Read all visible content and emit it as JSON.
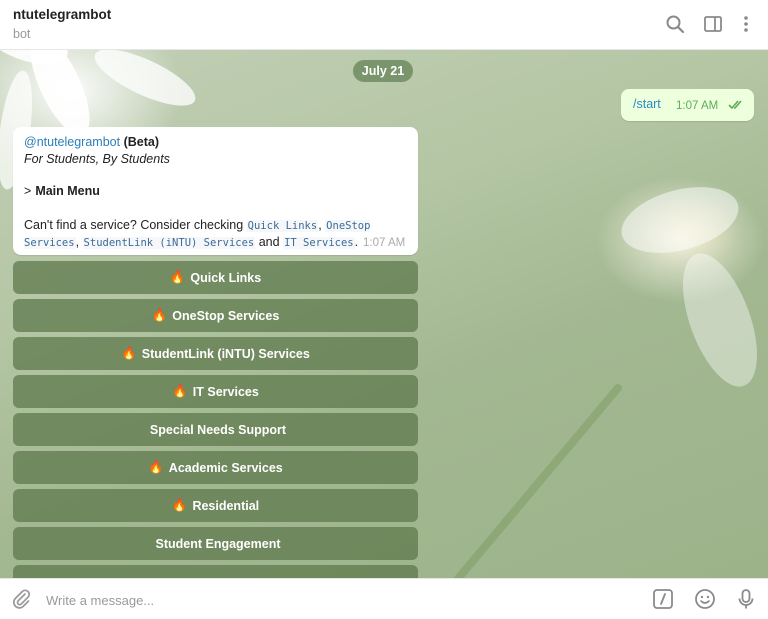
{
  "header": {
    "title": "ntutelegrambot",
    "subtitle": "bot"
  },
  "chat": {
    "date_label": "July 21",
    "outgoing": {
      "text": "/start",
      "time": "1:07 AM"
    },
    "incoming": {
      "mention": "@ntutelegrambot",
      "beta": "(Beta)",
      "tagline": "For Students, By Students",
      "arrow": ">",
      "menu_label": "Main Menu",
      "help_prefix": "Can't find a service? Consider checking",
      "link_quick": "Quick Links",
      "sep1": ",",
      "link_onestop": "OneStop Services",
      "sep2": ",",
      "link_studentlink": "StudentLink (iNTU) Services",
      "and_word": "and",
      "link_it": "IT Services",
      "period": ".",
      "time": "1:07 AM"
    },
    "keyboard": [
      {
        "fire": "🔥",
        "label": "Quick Links"
      },
      {
        "fire": "🔥",
        "label": "OneStop Services"
      },
      {
        "fire": "🔥",
        "label": "StudentLink (iNTU) Services"
      },
      {
        "fire": "🔥",
        "label": "IT Services"
      },
      {
        "fire": "",
        "label": "Special Needs Support"
      },
      {
        "fire": "🔥",
        "label": "Academic Services"
      },
      {
        "fire": "🔥",
        "label": "Residential"
      },
      {
        "fire": "",
        "label": "Student Engagement"
      }
    ]
  },
  "composer": {
    "placeholder": "Write a message..."
  },
  "colors": {
    "accent": "#2a7fba",
    "keyboard_button": "#5c764a",
    "outgoing_bubble": "#eeffde",
    "outgoing_time": "#5fac55"
  },
  "icons": {
    "header": [
      "search-icon",
      "sidebar-toggle-icon",
      "more-vertical-icon"
    ],
    "composer": [
      "attach-icon",
      "bot-command-icon",
      "emoji-icon",
      "microphone-icon"
    ]
  }
}
